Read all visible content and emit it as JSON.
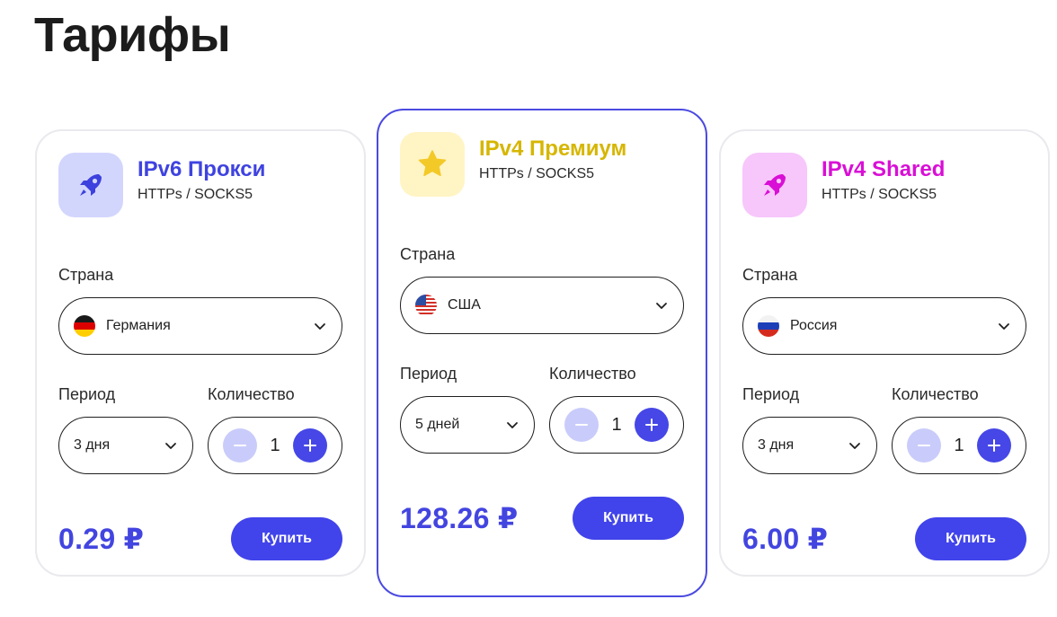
{
  "title": "Тарифы",
  "labels": {
    "country": "Страна",
    "period": "Период",
    "quantity": "Количество",
    "buy": "Купить"
  },
  "plans": [
    {
      "name": "IPv6 Прокси",
      "protocols": "HTTPs / SOCKS5",
      "name_color": "#3f43e0",
      "badge_bg": "#d2d6fd",
      "icon": "rocket-icon",
      "icon_color": "#3d41dd",
      "country": "Германия",
      "flag": "germany-flag-icon",
      "period": "3 дня",
      "quantity": "1",
      "price": "0.29 ₽",
      "featured": false
    },
    {
      "name": "IPv4 Премиум",
      "protocols": "HTTPs / SOCKS5",
      "name_color": "#d6b600",
      "badge_bg": "#fff4c4",
      "icon": "star-icon",
      "icon_color": "#f3c928",
      "country": "США",
      "flag": "usa-flag-icon",
      "period": "5 дней",
      "quantity": "1",
      "price": "128.26 ₽",
      "featured": true
    },
    {
      "name": "IPv4 Shared",
      "protocols": "HTTPs / SOCKS5",
      "name_color": "#d90fd6",
      "badge_bg": "#f7c6fb",
      "icon": "rocket-icon",
      "icon_color": "#d90fd6",
      "country": "Россия",
      "flag": "russia-flag-icon",
      "period": "3 дня",
      "quantity": "1",
      "price": "6.00 ₽",
      "featured": false
    }
  ]
}
